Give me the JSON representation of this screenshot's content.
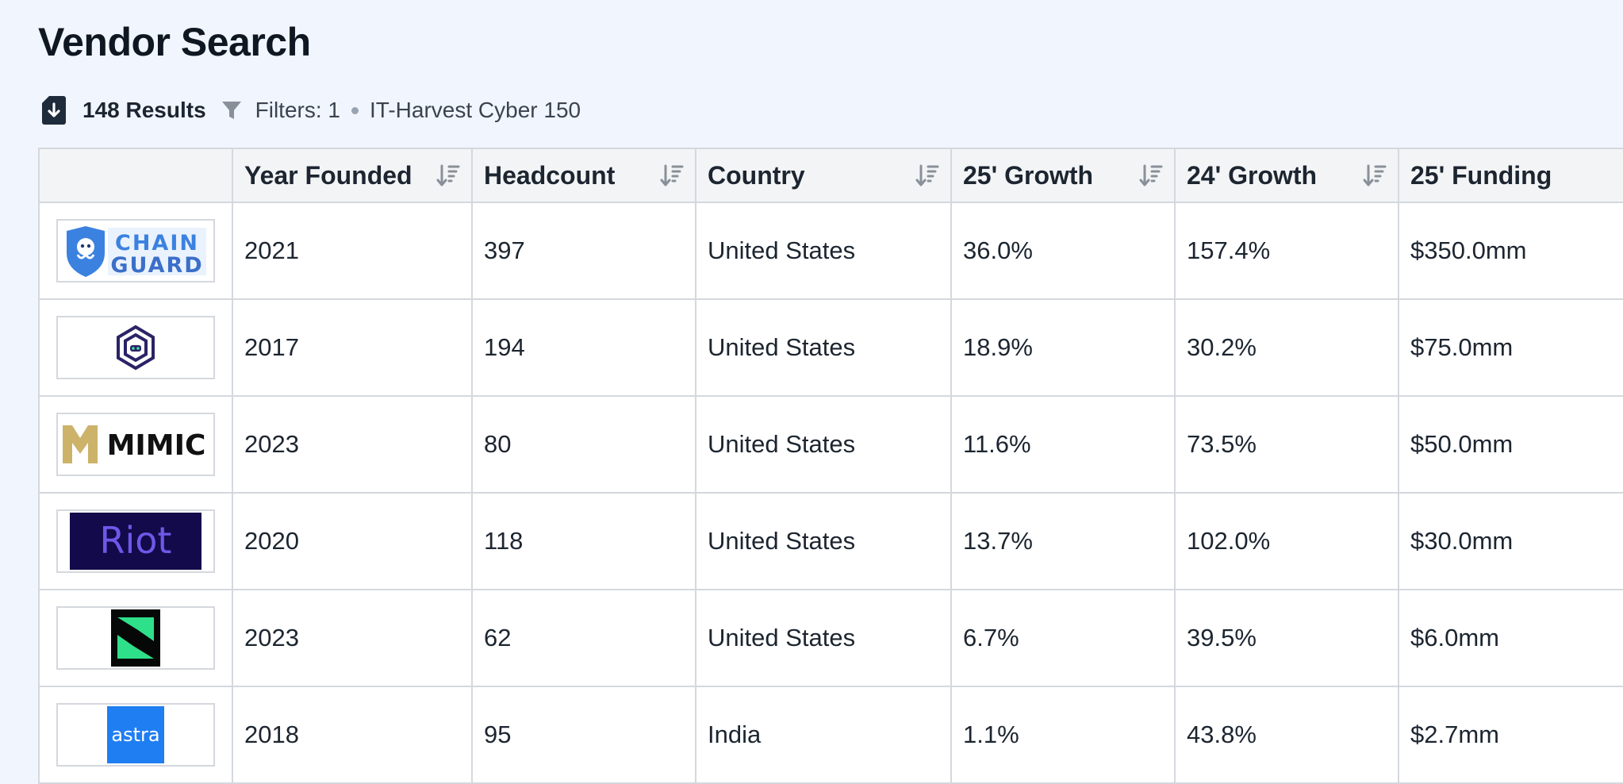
{
  "page": {
    "title": "Vendor Search"
  },
  "results": {
    "count_label": "148 Results",
    "filters_label": "Filters: 1",
    "filter_name": "IT-Harvest Cyber 150"
  },
  "table": {
    "columns": [
      {
        "label": ""
      },
      {
        "label": "Year Founded",
        "sort_active": false
      },
      {
        "label": "Headcount",
        "sort_active": false
      },
      {
        "label": "Country",
        "sort_active": false
      },
      {
        "label": "25' Growth",
        "sort_active": false
      },
      {
        "label": "24' Growth",
        "sort_active": false
      },
      {
        "label": "25' Funding",
        "sort_active": true
      }
    ],
    "rows": [
      {
        "logo": "chainguard-logo",
        "logo_text": [
          "CHAIN",
          "GUARD"
        ],
        "year": "2021",
        "headcount": "397",
        "country": "United States",
        "growth_25": "36.0%",
        "growth_24": "157.4%",
        "funding_25": "$350.0mm"
      },
      {
        "logo": "hexagon-logo",
        "year": "2017",
        "headcount": "194",
        "country": "United States",
        "growth_25": "18.9%",
        "growth_24": "30.2%",
        "funding_25": "$75.0mm"
      },
      {
        "logo": "mimic-logo",
        "logo_text": "MIMIC",
        "year": "2023",
        "headcount": "80",
        "country": "United States",
        "growth_25": "11.6%",
        "growth_24": "73.5%",
        "funding_25": "$50.0mm"
      },
      {
        "logo": "riot-logo",
        "logo_text": "Riot",
        "year": "2020",
        "headcount": "118",
        "country": "United States",
        "growth_25": "13.7%",
        "growth_24": "102.0%",
        "funding_25": "$30.0mm"
      },
      {
        "logo": "green-square-logo",
        "year": "2023",
        "headcount": "62",
        "country": "United States",
        "growth_25": "6.7%",
        "growth_24": "39.5%",
        "funding_25": "$6.0mm"
      },
      {
        "logo": "astra-logo",
        "logo_text": "astra",
        "year": "2018",
        "headcount": "95",
        "country": "India",
        "growth_25": "1.1%",
        "growth_24": "43.8%",
        "funding_25": "$2.7mm"
      }
    ]
  },
  "colors": {
    "background": "#f1f5fd",
    "sort_active": "#2f7fd8",
    "sort_inactive": "#8a9099",
    "chainguard_blue": "#3b82e0",
    "riot_bg": "#120a4a",
    "riot_text": "#6f57e8",
    "mimic_gold": "#cdb26a",
    "green_logo": "#2ee08a",
    "astra_blue": "#1f7ef2"
  }
}
